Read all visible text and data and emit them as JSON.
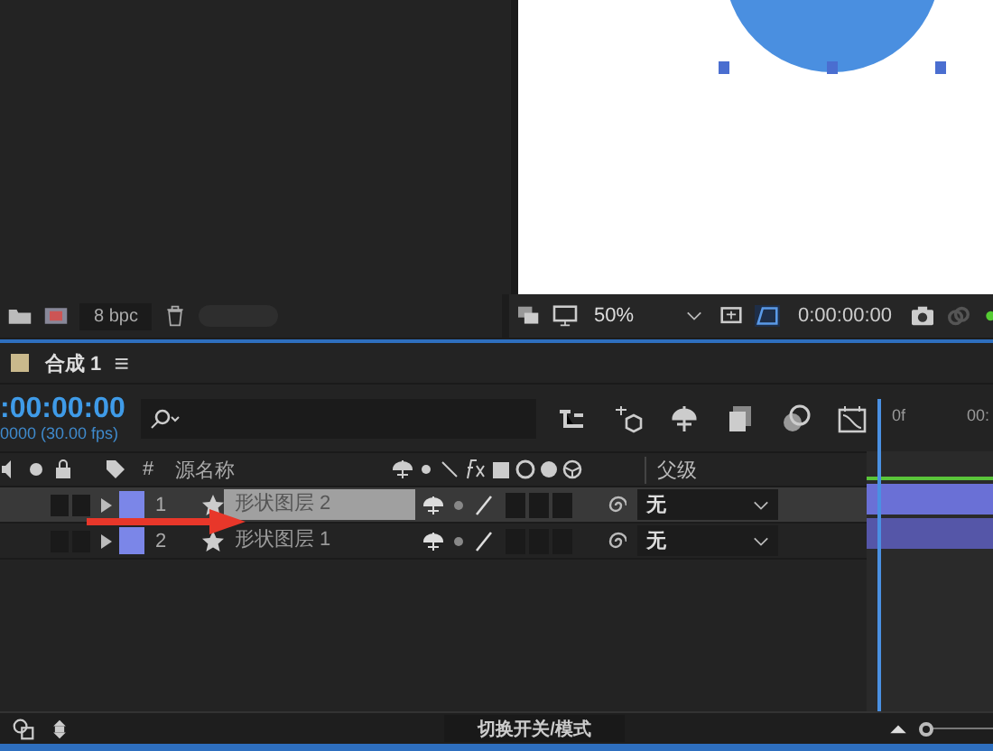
{
  "project_footer": {
    "bit_depth": "8 bpc"
  },
  "viewer": {
    "zoom": "50%",
    "timecode": "0:00:00:00"
  },
  "composition_tab": {
    "title": "合成 1",
    "menu_glyph": "≡"
  },
  "timeline": {
    "timecode": ":00:00:00",
    "fps": "0000 (30.00 fps)",
    "ruler_labels": [
      "0f",
      "00:"
    ],
    "columns": {
      "number": "#",
      "source_name": "源名称",
      "parent": "父级"
    },
    "layers": [
      {
        "number": "1",
        "name": "形状图层 2",
        "parent": "无",
        "selected": true
      },
      {
        "number": "2",
        "name": "形状图层 1",
        "parent": "无",
        "selected": false
      }
    ],
    "toggle_label": "切换开关/模式",
    "zoom_slider": {
      "level": 0.0
    }
  }
}
